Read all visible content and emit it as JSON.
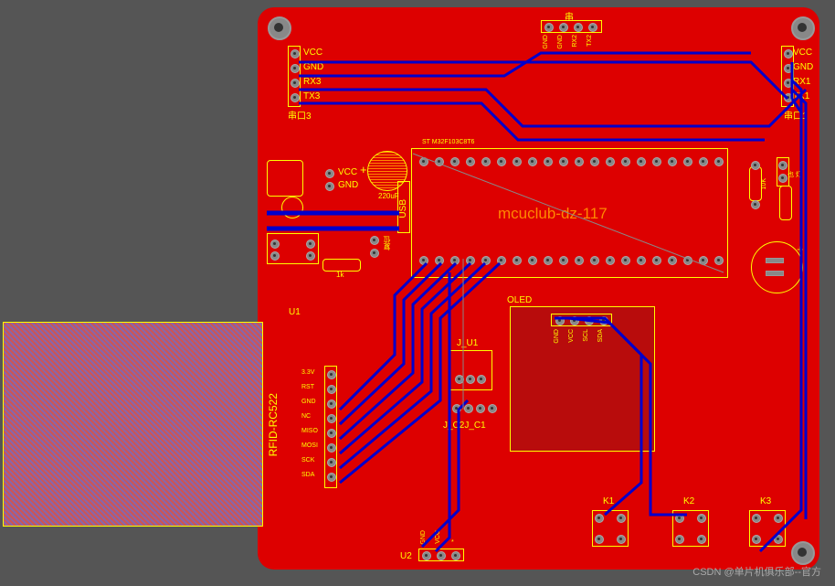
{
  "board": {
    "title": "mcuclub-dz-117",
    "mcu_label": "ST M32F103C8T6"
  },
  "connectors": {
    "serial3": {
      "name": "串口3",
      "pins": [
        "VCC",
        "GND",
        "RX3",
        "TX3"
      ]
    },
    "serial1": {
      "name": "串口1",
      "pins": [
        "VCC",
        "GND",
        "RX1",
        "TX1"
      ]
    },
    "usb_header": {
      "name": "串",
      "pins": [
        "GND",
        "GND",
        "RX2",
        "TX2"
      ]
    },
    "power": {
      "pins": [
        "VCC",
        "GND"
      ]
    },
    "usb_label": "USB"
  },
  "components": {
    "cap": "220uF",
    "res1": "1k",
    "res2": "10K",
    "rfid": {
      "ref": "U1",
      "name": "RFID-RC522",
      "pins": [
        "3.3V",
        "RST",
        "GND",
        "NC",
        "MISO",
        "MOSI",
        "SCK",
        "SDA"
      ]
    },
    "oled": {
      "name": "OLED",
      "pins": [
        "GND",
        "VCC",
        "SCL",
        "SDA"
      ]
    },
    "u2": "U2",
    "reset": "复位",
    "jumpers": {
      "u1": "J_U1",
      "c": "J_C2J_C1"
    },
    "buttons": [
      "K1",
      "K2",
      "K3"
    ]
  },
  "u2_pins": [
    "GND",
    "VCC",
    "*"
  ],
  "watermark": "CSDN @单片机俱乐部--官方"
}
